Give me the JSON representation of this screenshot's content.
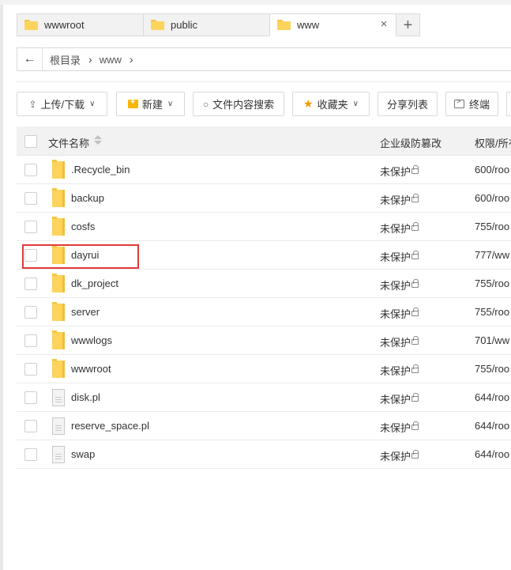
{
  "tabs": [
    {
      "label": "wwwroot",
      "active": false
    },
    {
      "label": "public",
      "active": false
    },
    {
      "label": "www",
      "active": true
    }
  ],
  "tab_close_glyph": "×",
  "tab_add_glyph": "+",
  "address": {
    "back_glyph": "←",
    "crumbs": [
      "根目录",
      "www"
    ],
    "sep_glyph": "›"
  },
  "toolbar": {
    "upload_label": "上传/下载",
    "new_label": "新建",
    "search_label": "文件内容搜索",
    "favorites_label": "收藏夹",
    "share_label": "分享列表",
    "terminal_label": "终端"
  },
  "table": {
    "col_name": "文件名称",
    "col_protect": "企业级防篡改",
    "col_perm": "权限/所有"
  },
  "files": [
    {
      "name": ".Recycle_bin",
      "type": "folder",
      "protect": "未保护",
      "perm": "600/roo"
    },
    {
      "name": "backup",
      "type": "folder",
      "protect": "未保护",
      "perm": "600/roo"
    },
    {
      "name": "cosfs",
      "type": "folder",
      "protect": "未保护",
      "perm": "755/roo"
    },
    {
      "name": "dayrui",
      "type": "folder",
      "protect": "未保护",
      "perm": "777/ww"
    },
    {
      "name": "dk_project",
      "type": "folder",
      "protect": "未保护",
      "perm": "755/roo"
    },
    {
      "name": "server",
      "type": "folder",
      "protect": "未保护",
      "perm": "755/roo"
    },
    {
      "name": "wwwlogs",
      "type": "folder",
      "protect": "未保护",
      "perm": "701/ww"
    },
    {
      "name": "wwwroot",
      "type": "folder",
      "protect": "未保护",
      "perm": "755/roo"
    },
    {
      "name": "disk.pl",
      "type": "file",
      "protect": "未保护",
      "perm": "644/roo"
    },
    {
      "name": "reserve_space.pl",
      "type": "file",
      "protect": "未保护",
      "perm": "644/roo"
    },
    {
      "name": "swap",
      "type": "file",
      "protect": "未保护",
      "perm": "644/roo"
    }
  ],
  "highlight_color": "#e03a3a",
  "accent_folder_color": "#fcd45c"
}
